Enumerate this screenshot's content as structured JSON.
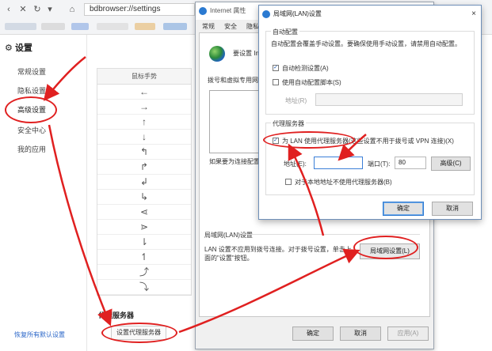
{
  "browser": {
    "address": "bdbrowser://settings"
  },
  "sidebar": {
    "title": "设置",
    "items": [
      {
        "label": "常规设置"
      },
      {
        "label": "隐私设置"
      },
      {
        "label": "高级设置"
      },
      {
        "label": "安全中心"
      },
      {
        "label": "我的应用"
      }
    ],
    "footer": "恢复所有默认设置"
  },
  "content": {
    "table_header": "鼠标手势",
    "gestures": [
      "←",
      "→",
      "↑",
      "↓",
      "↰",
      "↱",
      "↲",
      "↳",
      "⋖",
      "⋗",
      "⇂",
      "↿",
      "⤴",
      "⤵"
    ],
    "proxy_section_title": "代理服务器",
    "proxy_button": "设置代理服务器"
  },
  "inet_dialog": {
    "title": "Internet 属性",
    "tabs": [
      "常规",
      "安全",
      "隐私"
    ],
    "setup_text": "要设置 Int",
    "dialup_label": "拨号和虚拟专用网络",
    "proxy_note": "如果要为连接配置",
    "lan_title": "局域网(LAN)设置",
    "lan_desc": "LAN 设置不应用到拨号连接。对于拨号设置，单击上面的\"设置\"按钮。",
    "lan_button": "局域网设置(L)",
    "ok": "确定",
    "cancel": "取消",
    "apply": "应用(A)"
  },
  "lan_dialog": {
    "title": "局域网(LAN)设置",
    "close": "×",
    "auto_group": "自动配置",
    "auto_desc": "自动配置会覆盖手动设置。要确保使用手动设置，请禁用自动配置。",
    "auto_detect": "自动检测设置(A)",
    "auto_script": "使用自动配置脚本(S)",
    "address_label_top": "地址(R)",
    "proxy_group": "代理服务器",
    "use_proxy": "为 LAN 使用代理服务器(这些设置不用于拨号或 VPN 连接)(X)",
    "address_label": "地址(E):",
    "address_value": "",
    "port_label": "端口(T):",
    "port_value": "80",
    "advanced": "高级(C)",
    "bypass_local": "对于本地地址不使用代理服务器(B)",
    "ok": "确定",
    "cancel": "取消"
  }
}
